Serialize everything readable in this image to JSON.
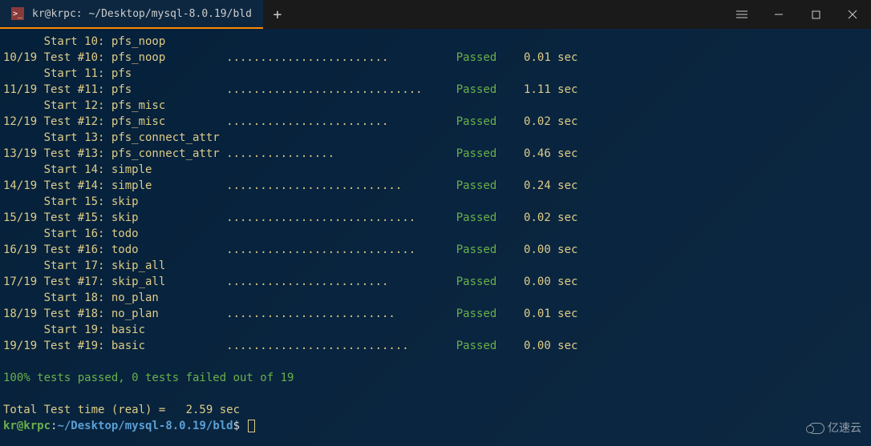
{
  "tab": {
    "title": "kr@krpc: ~/Desktop/mysql-8.0.19/bld",
    "icon_glyph": ">_"
  },
  "controls": {
    "add_tab": "+"
  },
  "tests": [
    {
      "start_idx": "10",
      "start_name": "pfs_noop",
      "counter": "10/19",
      "test_num": "#10",
      "test_name": "pfs_noop",
      "dots": "........................",
      "status": "Passed",
      "time": "0.01",
      "unit": "sec"
    },
    {
      "start_idx": "11",
      "start_name": "pfs",
      "counter": "11/19",
      "test_num": "#11",
      "test_name": "pfs",
      "dots": ".............................",
      "status": "Passed",
      "time": "1.11",
      "unit": "sec"
    },
    {
      "start_idx": "12",
      "start_name": "pfs_misc",
      "counter": "12/19",
      "test_num": "#12",
      "test_name": "pfs_misc",
      "dots": "........................",
      "status": "Passed",
      "time": "0.02",
      "unit": "sec"
    },
    {
      "start_idx": "13",
      "start_name": "pfs_connect_attr",
      "counter": "13/19",
      "test_num": "#13",
      "test_name": "pfs_connect_attr",
      "dots": "................",
      "status": "Passed",
      "time": "0.46",
      "unit": "sec"
    },
    {
      "start_idx": "14",
      "start_name": "simple",
      "counter": "14/19",
      "test_num": "#14",
      "test_name": "simple",
      "dots": "..........................",
      "status": "Passed",
      "time": "0.24",
      "unit": "sec"
    },
    {
      "start_idx": "15",
      "start_name": "skip",
      "counter": "15/19",
      "test_num": "#15",
      "test_name": "skip",
      "dots": "............................",
      "status": "Passed",
      "time": "0.02",
      "unit": "sec"
    },
    {
      "start_idx": "16",
      "start_name": "todo",
      "counter": "16/19",
      "test_num": "#16",
      "test_name": "todo",
      "dots": "............................",
      "status": "Passed",
      "time": "0.00",
      "unit": "sec"
    },
    {
      "start_idx": "17",
      "start_name": "skip_all",
      "counter": "17/19",
      "test_num": "#17",
      "test_name": "skip_all",
      "dots": "........................",
      "status": "Passed",
      "time": "0.00",
      "unit": "sec"
    },
    {
      "start_idx": "18",
      "start_name": "no_plan",
      "counter": "18/19",
      "test_num": "#18",
      "test_name": "no_plan",
      "dots": ".........................",
      "status": "Passed",
      "time": "0.01",
      "unit": "sec"
    },
    {
      "start_idx": "19",
      "start_name": "basic",
      "counter": "19/19",
      "test_num": "#19",
      "test_name": "basic",
      "dots": "...........................",
      "status": "Passed",
      "time": "0.00",
      "unit": "sec"
    }
  ],
  "summary": {
    "line1": "100% tests passed, 0 tests failed out of 19",
    "line2": "Total Test time (real) =   2.59 sec"
  },
  "prompt": {
    "user": "kr@krpc",
    "colon": ":",
    "path": "~/Desktop/mysql-8.0.19/bld",
    "dollar": "$"
  },
  "watermark": "亿速云"
}
